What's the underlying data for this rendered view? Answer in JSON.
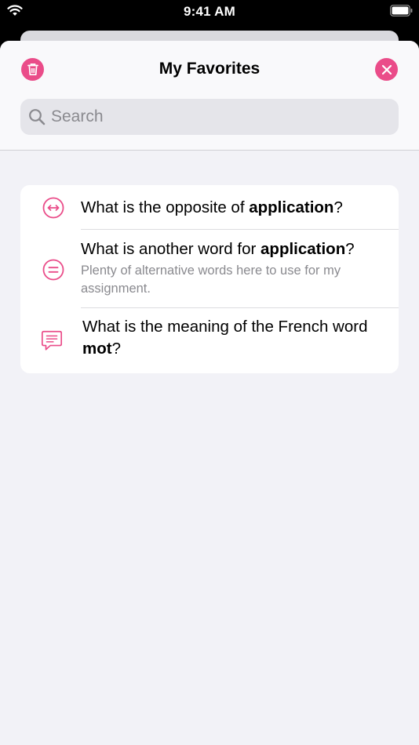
{
  "status_bar": {
    "time": "9:41 AM"
  },
  "header": {
    "title": "My Favorites",
    "trash_icon": "trash-icon",
    "close_icon": "close-icon"
  },
  "search": {
    "placeholder": "Search"
  },
  "favorites": [
    {
      "icon": "opposite-arrows-icon",
      "title_prefix": "What is the opposite of ",
      "title_bold": "application",
      "title_suffix": "?"
    },
    {
      "icon": "equals-icon",
      "title_prefix": "What is another word for ",
      "title_bold": "application",
      "title_suffix": "?",
      "subtitle": "Plenty of alternative words here to use for my assignment."
    },
    {
      "icon": "chat-bubble-icon",
      "title_prefix": "What is the meaning of the French word ",
      "title_bold": "mot",
      "title_suffix": "?"
    }
  ],
  "colors": {
    "accent": "#ea4c89",
    "background": "#f2f2f7"
  }
}
